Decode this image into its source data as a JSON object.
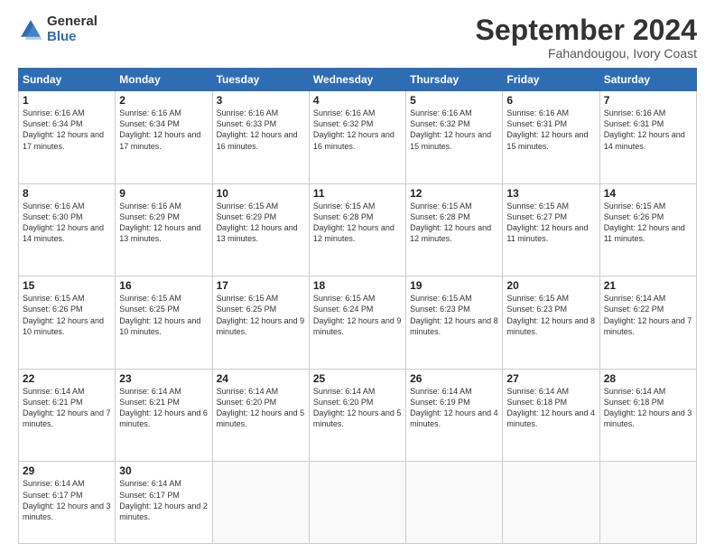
{
  "logo": {
    "general": "General",
    "blue": "Blue"
  },
  "header": {
    "month": "September 2024",
    "location": "Fahandougou, Ivory Coast"
  },
  "weekdays": [
    "Sunday",
    "Monday",
    "Tuesday",
    "Wednesday",
    "Thursday",
    "Friday",
    "Saturday"
  ],
  "weeks": [
    [
      {
        "day": "1",
        "sunrise": "6:16 AM",
        "sunset": "6:34 PM",
        "daylight": "12 hours and 17 minutes."
      },
      {
        "day": "2",
        "sunrise": "6:16 AM",
        "sunset": "6:34 PM",
        "daylight": "12 hours and 17 minutes."
      },
      {
        "day": "3",
        "sunrise": "6:16 AM",
        "sunset": "6:33 PM",
        "daylight": "12 hours and 16 minutes."
      },
      {
        "day": "4",
        "sunrise": "6:16 AM",
        "sunset": "6:32 PM",
        "daylight": "12 hours and 16 minutes."
      },
      {
        "day": "5",
        "sunrise": "6:16 AM",
        "sunset": "6:32 PM",
        "daylight": "12 hours and 15 minutes."
      },
      {
        "day": "6",
        "sunrise": "6:16 AM",
        "sunset": "6:31 PM",
        "daylight": "12 hours and 15 minutes."
      },
      {
        "day": "7",
        "sunrise": "6:16 AM",
        "sunset": "6:31 PM",
        "daylight": "12 hours and 14 minutes."
      }
    ],
    [
      {
        "day": "8",
        "sunrise": "6:16 AM",
        "sunset": "6:30 PM",
        "daylight": "12 hours and 14 minutes."
      },
      {
        "day": "9",
        "sunrise": "6:16 AM",
        "sunset": "6:29 PM",
        "daylight": "12 hours and 13 minutes."
      },
      {
        "day": "10",
        "sunrise": "6:15 AM",
        "sunset": "6:29 PM",
        "daylight": "12 hours and 13 minutes."
      },
      {
        "day": "11",
        "sunrise": "6:15 AM",
        "sunset": "6:28 PM",
        "daylight": "12 hours and 12 minutes."
      },
      {
        "day": "12",
        "sunrise": "6:15 AM",
        "sunset": "6:28 PM",
        "daylight": "12 hours and 12 minutes."
      },
      {
        "day": "13",
        "sunrise": "6:15 AM",
        "sunset": "6:27 PM",
        "daylight": "12 hours and 11 minutes."
      },
      {
        "day": "14",
        "sunrise": "6:15 AM",
        "sunset": "6:26 PM",
        "daylight": "12 hours and 11 minutes."
      }
    ],
    [
      {
        "day": "15",
        "sunrise": "6:15 AM",
        "sunset": "6:26 PM",
        "daylight": "12 hours and 10 minutes."
      },
      {
        "day": "16",
        "sunrise": "6:15 AM",
        "sunset": "6:25 PM",
        "daylight": "12 hours and 10 minutes."
      },
      {
        "day": "17",
        "sunrise": "6:15 AM",
        "sunset": "6:25 PM",
        "daylight": "12 hours and 9 minutes."
      },
      {
        "day": "18",
        "sunrise": "6:15 AM",
        "sunset": "6:24 PM",
        "daylight": "12 hours and 9 minutes."
      },
      {
        "day": "19",
        "sunrise": "6:15 AM",
        "sunset": "6:23 PM",
        "daylight": "12 hours and 8 minutes."
      },
      {
        "day": "20",
        "sunrise": "6:15 AM",
        "sunset": "6:23 PM",
        "daylight": "12 hours and 8 minutes."
      },
      {
        "day": "21",
        "sunrise": "6:14 AM",
        "sunset": "6:22 PM",
        "daylight": "12 hours and 7 minutes."
      }
    ],
    [
      {
        "day": "22",
        "sunrise": "6:14 AM",
        "sunset": "6:21 PM",
        "daylight": "12 hours and 7 minutes."
      },
      {
        "day": "23",
        "sunrise": "6:14 AM",
        "sunset": "6:21 PM",
        "daylight": "12 hours and 6 minutes."
      },
      {
        "day": "24",
        "sunrise": "6:14 AM",
        "sunset": "6:20 PM",
        "daylight": "12 hours and 5 minutes."
      },
      {
        "day": "25",
        "sunrise": "6:14 AM",
        "sunset": "6:20 PM",
        "daylight": "12 hours and 5 minutes."
      },
      {
        "day": "26",
        "sunrise": "6:14 AM",
        "sunset": "6:19 PM",
        "daylight": "12 hours and 4 minutes."
      },
      {
        "day": "27",
        "sunrise": "6:14 AM",
        "sunset": "6:18 PM",
        "daylight": "12 hours and 4 minutes."
      },
      {
        "day": "28",
        "sunrise": "6:14 AM",
        "sunset": "6:18 PM",
        "daylight": "12 hours and 3 minutes."
      }
    ],
    [
      {
        "day": "29",
        "sunrise": "6:14 AM",
        "sunset": "6:17 PM",
        "daylight": "12 hours and 3 minutes."
      },
      {
        "day": "30",
        "sunrise": "6:14 AM",
        "sunset": "6:17 PM",
        "daylight": "12 hours and 2 minutes."
      },
      null,
      null,
      null,
      null,
      null
    ]
  ]
}
